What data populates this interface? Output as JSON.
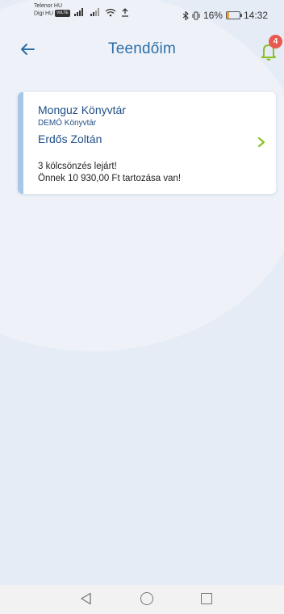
{
  "status_bar": {
    "carrier1": "Telenor HU",
    "carrier2": "Digi HU",
    "volte": "VoLTE",
    "battery_percent": "16%",
    "time": "14:32",
    "battery_level": 0.16
  },
  "header": {
    "title": "Teendőim",
    "notification_count": "4"
  },
  "card": {
    "library_name": "Monguz Könyvtár",
    "library_sub": "DEMÓ Könyvtár",
    "user_name": "Erdős Zoltán",
    "message1": "3 kölcsönzés lejárt!",
    "message2": "Önnek 10 930,00 Ft tartozása van!"
  },
  "colors": {
    "accent": "#2d6ea8",
    "bell": "#8cbf26",
    "badge": "#e85a4f",
    "card_stripe": "#a8c7e8"
  }
}
